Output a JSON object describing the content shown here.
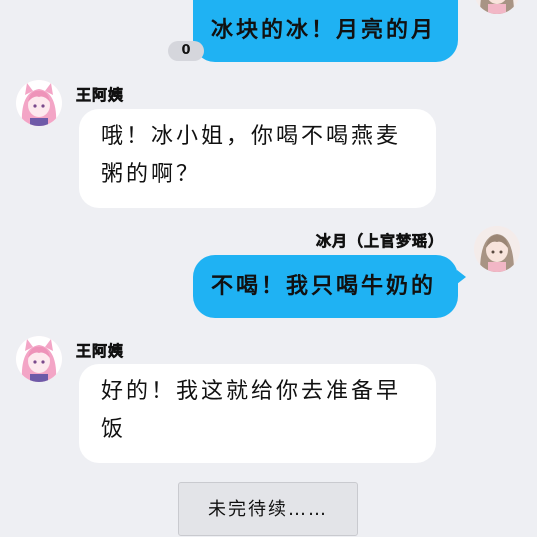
{
  "messages": [
    {
      "side": "right",
      "sender": "",
      "text": "冰块的冰！月亮的月"
    },
    {
      "side": "left",
      "sender": "王阿姨",
      "line1": "哦！冰小姐，你喝不喝燕麦",
      "line2": "粥的啊？"
    },
    {
      "side": "right",
      "sender": "冰月（上官梦瑶）",
      "text": "不喝！我只喝牛奶的"
    },
    {
      "side": "left",
      "sender": "王阿姨",
      "line1": "好的！我这就给你去准备早",
      "line2": "饭"
    }
  ],
  "read_badge": "0",
  "continue_label": "未完待续……",
  "colors": {
    "background": "#eeeff3",
    "right_bubble": "#1fb2f3",
    "left_bubble": "#ffffff"
  },
  "icons": {
    "aunt_avatar": "pink-hair-girl-avatar",
    "bingyue_avatar": "brown-hair-girl-avatar"
  }
}
